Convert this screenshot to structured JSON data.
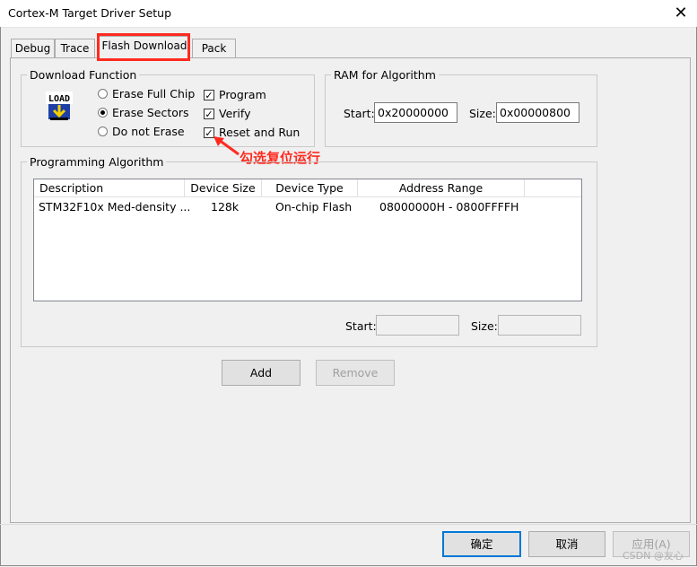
{
  "window": {
    "title": "Cortex-M Target Driver Setup",
    "close_glyph": "✕"
  },
  "tabs": [
    {
      "label": "Debug"
    },
    {
      "label": "Trace"
    },
    {
      "label": "Flash Download"
    },
    {
      "label": "Pack"
    }
  ],
  "download_function": {
    "legend": "Download Function",
    "icon": "load-icon",
    "icon_text": "LOAD",
    "radios": [
      {
        "label": "Erase Full Chip",
        "checked": false
      },
      {
        "label": "Erase Sectors",
        "checked": true
      },
      {
        "label": "Do not Erase",
        "checked": false
      }
    ],
    "checks": [
      {
        "label": "Program",
        "checked": true
      },
      {
        "label": "Verify",
        "checked": true
      },
      {
        "label": "Reset and Run",
        "checked": true
      }
    ]
  },
  "ram": {
    "legend": "RAM for Algorithm",
    "start_label": "Start:",
    "start_value": "0x20000000",
    "size_label": "Size:",
    "size_value": "0x00000800"
  },
  "annotation": {
    "text": "勾选复位运行",
    "color": "#ff2a1f"
  },
  "programming": {
    "legend": "Programming Algorithm",
    "columns": [
      "Description",
      "Device Size",
      "Device Type",
      "Address Range"
    ],
    "rows": [
      [
        "STM32F10x Med-density ...",
        "128k",
        "On-chip Flash",
        "08000000H - 0800FFFFH"
      ]
    ],
    "start_label": "Start:",
    "start_value": "",
    "size_label": "Size:",
    "size_value": ""
  },
  "buttons": {
    "add": "Add",
    "remove": "Remove"
  },
  "footer": {
    "ok": "确定",
    "cancel": "取消",
    "apply": "应用(A)"
  },
  "watermark": "CSDN @友心"
}
